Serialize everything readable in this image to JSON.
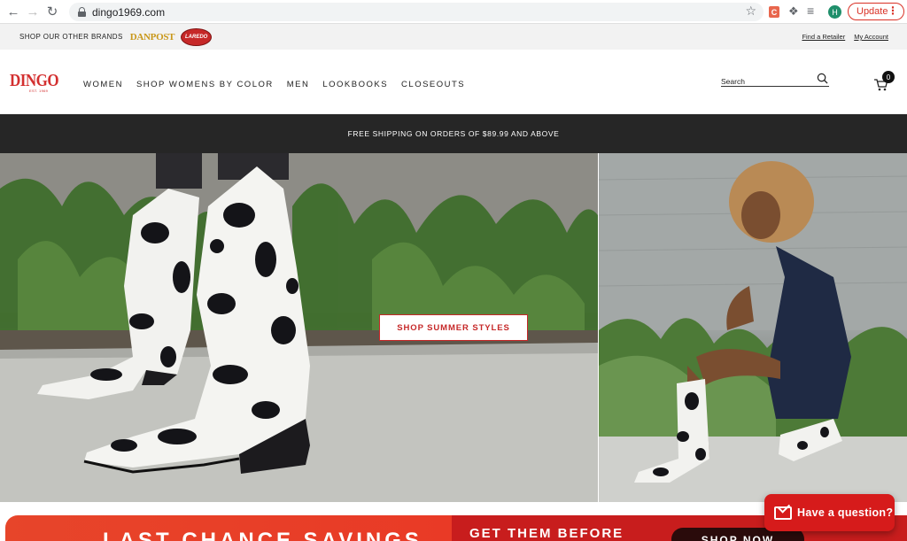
{
  "browser": {
    "url": "dingo1969.com",
    "update_label": "Update",
    "avatar_initial": "H",
    "extension_letter": "C"
  },
  "utility": {
    "other_brands": "SHOP OUR OTHER BRANDS",
    "brand_danpost": "DANPOST",
    "brand_laredo": "LAREDO",
    "find_retailer": "Find a Retailer",
    "my_account": "My Account"
  },
  "header": {
    "logo_text": "DINGO",
    "logo_est": "EST. 1969",
    "nav": [
      "WOMEN",
      "SHOP WOMENS BY COLOR",
      "MEN",
      "LOOKBOOKS",
      "CLOSEOUTS"
    ],
    "search_placeholder": "Search",
    "cart_count": "0"
  },
  "announcement": "FREE SHIPPING ON ORDERS OF $89.99 AND ABOVE",
  "hero": {
    "cta": "SHOP SUMMER STYLES"
  },
  "promo": {
    "title": "LAST CHANCE SAVINGS",
    "subtitle": "GET THEM BEFORE",
    "button": "SHOP NOW"
  },
  "chat": {
    "label": "Have a question?"
  },
  "colors": {
    "brand_red": "#c62828",
    "announce_bg": "#262626",
    "chat_red": "#d61b1b",
    "danpost_gold": "#c9981b"
  }
}
